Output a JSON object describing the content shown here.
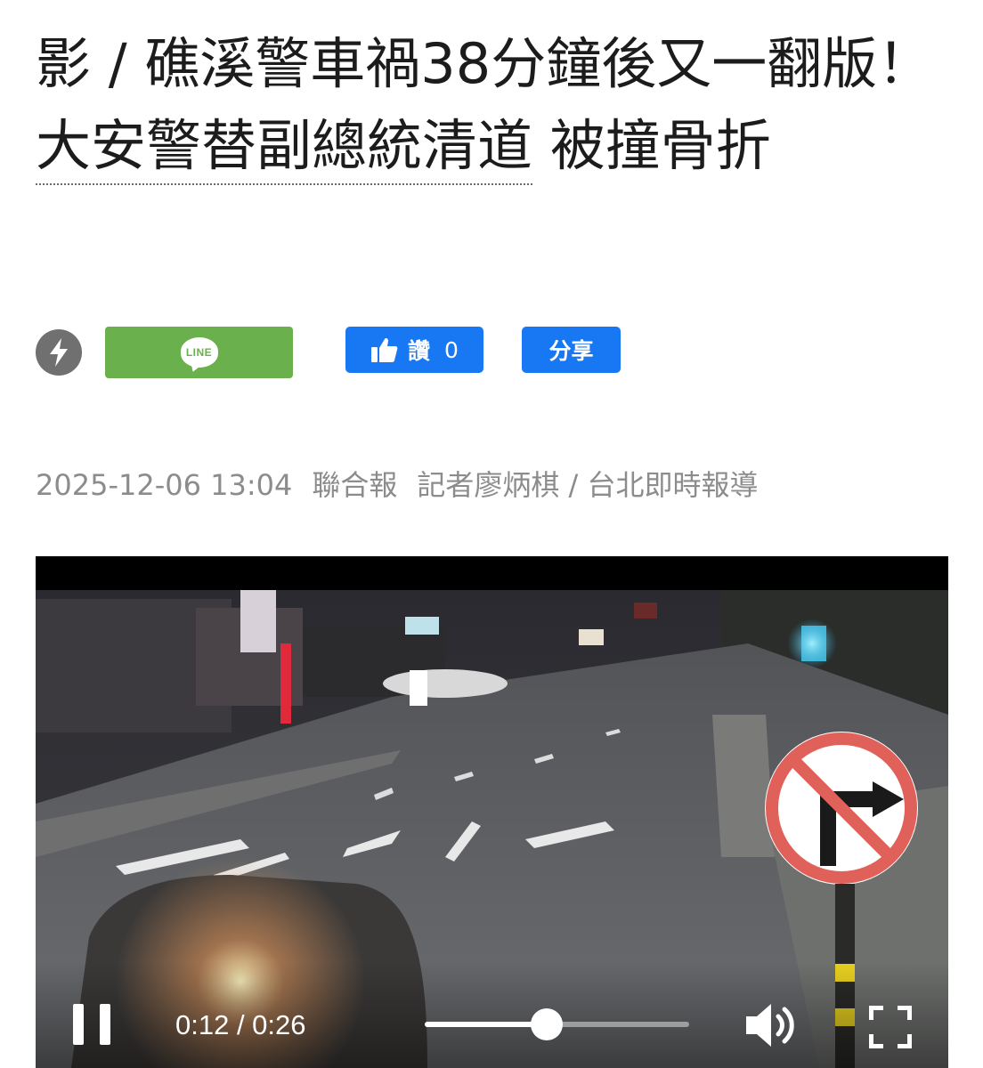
{
  "article": {
    "headline_part1": "影 / 礁溪警車禍38分鐘後又一翻版！",
    "headline_link": "大安警替副總統清道",
    "headline_part2": " 被撞骨折",
    "date": "2025-12-06 13:04",
    "source": "聯合報",
    "byline": "記者廖炳棋 / 台北即時報導"
  },
  "share_bar": {
    "amp_icon": "lightning-bolt-icon",
    "line_label": "LINE",
    "like_label": "讚",
    "like_count": "0",
    "share_label": "分享",
    "colors": {
      "line": "#6ab04c",
      "facebook": "#1877f2",
      "amp": "#707070"
    }
  },
  "video": {
    "time_display": "0:12 / 0:26",
    "progress": 0.46,
    "state": "playing",
    "icons": [
      "pause-icon",
      "volume-icon",
      "fullscreen-icon"
    ]
  }
}
